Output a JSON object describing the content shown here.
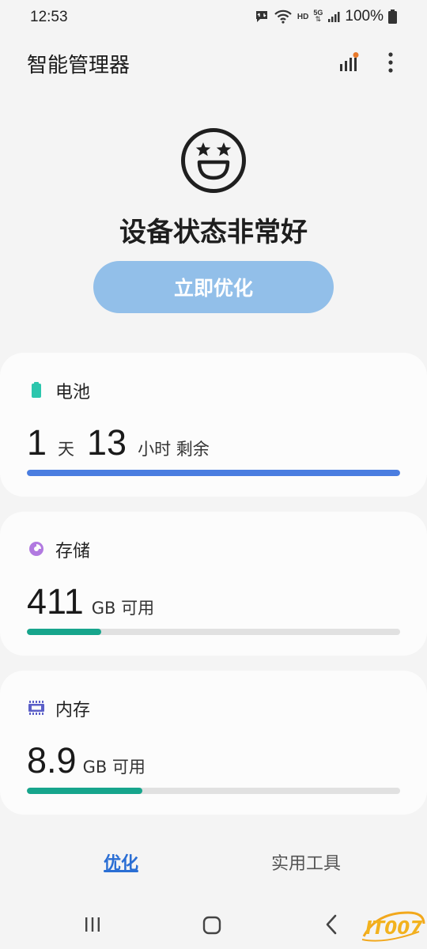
{
  "status_bar": {
    "time": "12:53",
    "hd": "HD",
    "network": "5G",
    "battery_percent": "100%"
  },
  "header": {
    "title": "智能管理器",
    "icons": [
      "signal-bars-icon",
      "more-options-icon"
    ],
    "notification_dot_color": "#e8792b"
  },
  "hero": {
    "face_icon": "star-eyes-smiley-icon",
    "status_text": "设备状态非常好",
    "optimize_button": "立即优化"
  },
  "battery": {
    "title": "电池",
    "icon": "battery-icon",
    "days_value": "1",
    "days_unit": "天",
    "hours_value": "13",
    "hours_unit": "小时 剩余",
    "level_fraction": 1.0,
    "color": "#4a7de0"
  },
  "storage": {
    "title": "存储",
    "icon": "pie-chart-icon",
    "value": "411",
    "unit": "GB 可用",
    "used_fraction": 0.2,
    "color": "#17a58c"
  },
  "memory": {
    "title": "内存",
    "icon": "memory-chip-icon",
    "value": "8.9",
    "unit": "GB 可用",
    "used_fraction": 0.31,
    "color": "#17a58c"
  },
  "tabs": {
    "optimize": "优化",
    "tools": "实用工具"
  },
  "watermark": "IT007"
}
